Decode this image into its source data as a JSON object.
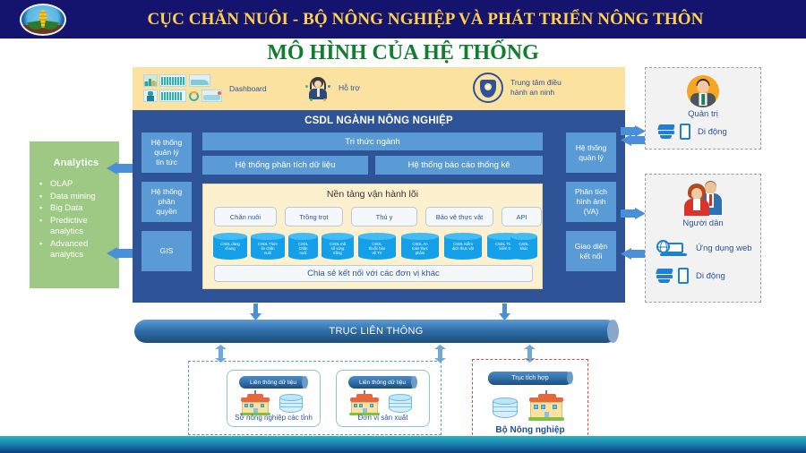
{
  "header": {
    "title": "CỤC CHĂN NUÔI - BỘ NÔNG NGHIỆP VÀ PHÁT TRIỂN NÔNG THÔN",
    "logo_name": "cuc-chan-nuoi-logo"
  },
  "slide": {
    "title": "MÔ HÌNH CỦA HỆ THỐNG"
  },
  "top_strip": {
    "items": [
      {
        "label": "Dashboard",
        "icon": "dashboard-icon"
      },
      {
        "label": "Hỗ trợ",
        "icon": "support-agent-icon"
      },
      {
        "label": "Trung tâm điều\nhành an ninh",
        "icon": "security-shield-icon"
      }
    ]
  },
  "analytics": {
    "title": "Analytics",
    "items": [
      "OLAP",
      "Data mining",
      "Big Data",
      "Predictive\nanalytics",
      "Advanced\nanalytics"
    ],
    "color": "#9DC985"
  },
  "main_panel": {
    "title": "CSDL NGÀNH NÔNG NGHIỆP",
    "color": "#2E5396",
    "box_color": "#5B9BD5",
    "left_column": [
      "Hệ thống\nquản lý\ntin tức",
      "Hệ thống\nphân\nquyền",
      "GIS"
    ],
    "right_column": [
      "Hệ thống\nquản lý",
      "Phân tích\nhình ảnh\n(VA)",
      "Giao diện\nkết nối"
    ],
    "rows": {
      "knowledge": "Tri thức ngành",
      "analysis": "Hệ thống phân tích dữ liệu",
      "report": "Hệ thống báo cáo thống kê"
    },
    "core": {
      "title": "Nền tảng vận hành lõi",
      "chips": [
        "Chăn nuôi",
        "Trồng trọt",
        "Thú y",
        "Bảo vệ thực vật",
        "API"
      ],
      "databases": [
        "CSDL dùng\nchung",
        "CSDL Thức\năn chăn\nnuôi",
        "CSDL\nChăn\nnuôi",
        "CSDL mã\nsố vùng\ntrồng",
        "CSDL\nthuốc bảo\nvệ TV",
        "CSDL An\ntoàn thực\nphẩm",
        "CSDL Kiểm\ndịch thực vật",
        "CSDL Thanh\nkiểm tra",
        "CSDL\nkhác"
      ],
      "share_bar": "Chia sẻ kết nối với các đơn vị khác"
    }
  },
  "right_panels": [
    {
      "role": "Quản trị",
      "avatar": "admin-avatar-icon",
      "devices": [
        {
          "label": "Di động",
          "icon": "mobile-device-icon"
        }
      ]
    },
    {
      "role": "Người dân",
      "avatar": "citizens-avatar-icon",
      "devices": [
        {
          "label": "Ứng dụng web",
          "icon": "web-app-icon"
        },
        {
          "label": "Di động",
          "icon": "mobile-device-icon"
        }
      ]
    }
  ],
  "trunk": {
    "label": "TRỤC LIÊN THÔNG"
  },
  "bottom": {
    "blue_group": [
      {
        "pill": "Liên thông dữ liệu",
        "caption": "Sở nông nghiệp các tỉnh"
      },
      {
        "pill": "Liên thông dữ liệu",
        "caption": "Đơn vị sản xuất"
      }
    ],
    "red_group": {
      "pill": "Trục tích hợp",
      "caption": "Bộ Nông nghiệp"
    }
  }
}
